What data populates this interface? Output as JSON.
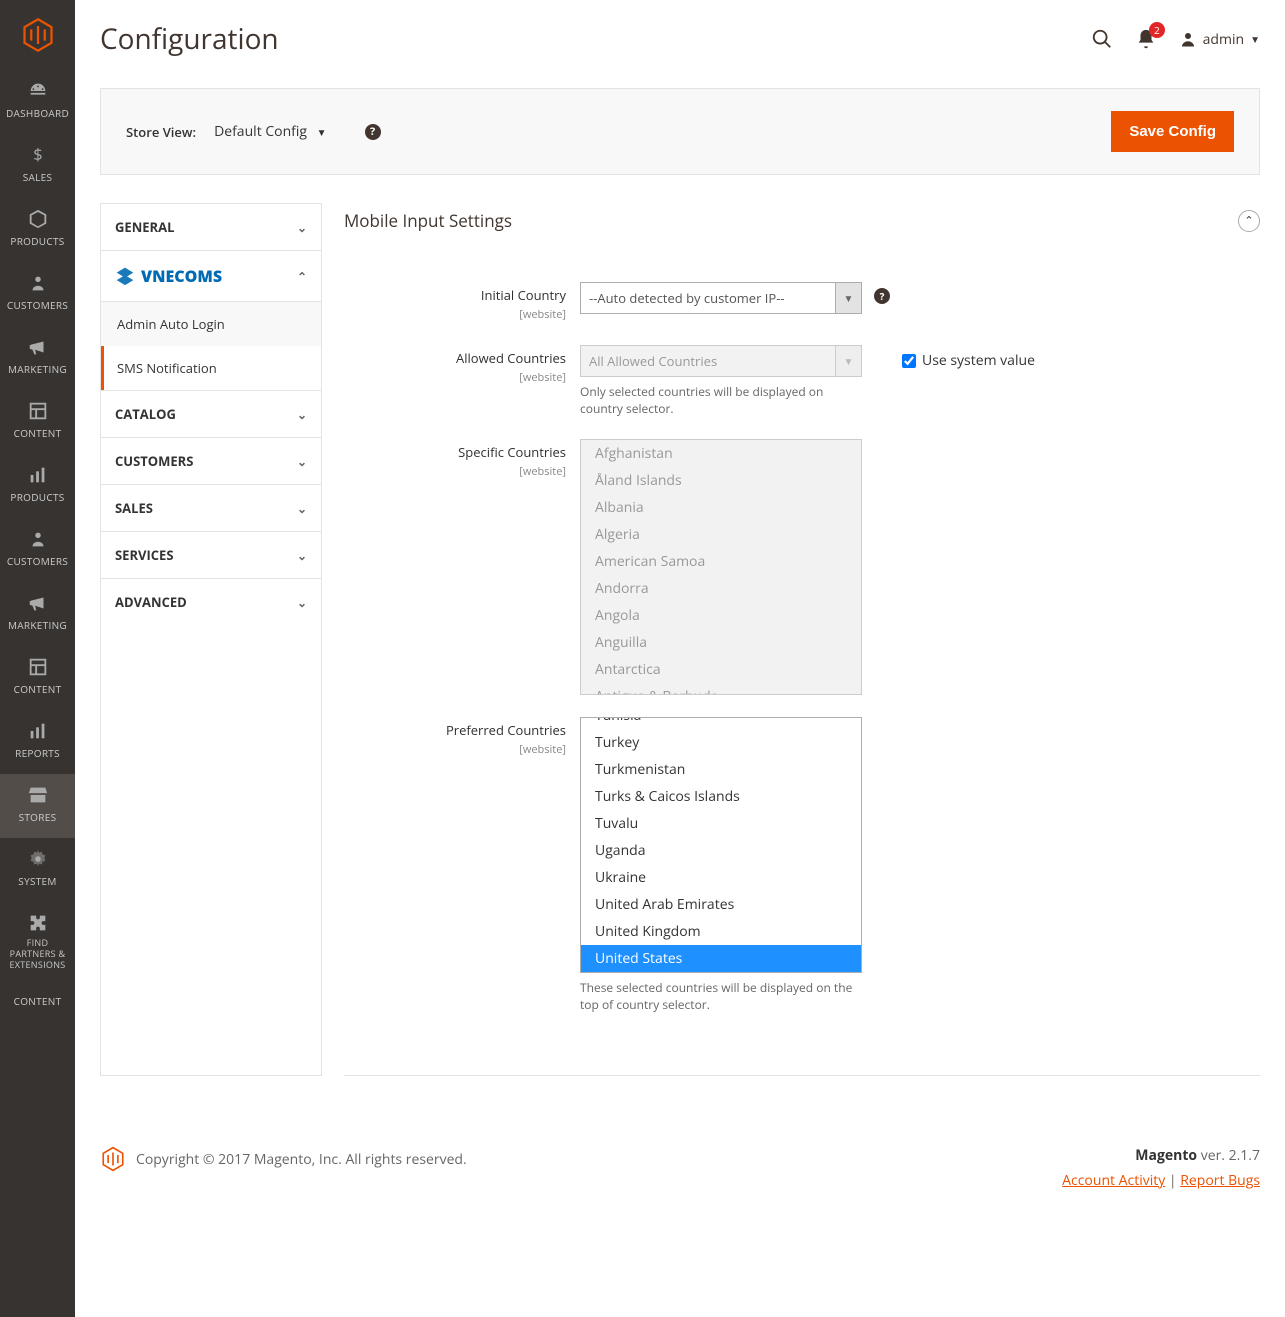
{
  "sidebar": {
    "items": [
      {
        "label": "DASHBOARD"
      },
      {
        "label": "SALES"
      },
      {
        "label": "PRODUCTS"
      },
      {
        "label": "CUSTOMERS"
      },
      {
        "label": "MARKETING"
      },
      {
        "label": "CONTENT"
      },
      {
        "label": "PRODUCTS"
      },
      {
        "label": "CUSTOMERS"
      },
      {
        "label": "MARKETING"
      },
      {
        "label": "CONTENT"
      },
      {
        "label": "REPORTS"
      },
      {
        "label": "STORES"
      },
      {
        "label": "SYSTEM"
      },
      {
        "label": "FIND PARTNERS & EXTENSIONS"
      },
      {
        "label": "CONTENT"
      }
    ]
  },
  "header": {
    "title": "Configuration",
    "notification_count": "2",
    "user": "admin"
  },
  "toolbar": {
    "store_view_label": "Store View:",
    "store_view_value": "Default Config",
    "save_label": "Save Config"
  },
  "config_nav": {
    "general": "GENERAL",
    "vnecoms": "VNECOMS",
    "vnecoms_sub": {
      "admin_auto_login": "Admin Auto Login",
      "sms_notification": "SMS Notification"
    },
    "catalog": "CATALOG",
    "customers": "CUSTOMERS",
    "sales": "SALES",
    "services": "SERVICES",
    "advanced": "ADVANCED"
  },
  "section": {
    "title": "Mobile Input Settings",
    "fields": {
      "initial_country": {
        "label": "Initial Country",
        "scope": "[website]",
        "value": "--Auto detected by customer IP--"
      },
      "allowed_countries": {
        "label": "Allowed Countries",
        "scope": "[website]",
        "value": "All Allowed Countries",
        "hint": "Only selected countries will be displayed on country selector.",
        "use_system_label": "Use system value"
      },
      "specific_countries": {
        "label": "Specific Countries",
        "scope": "[website]",
        "options": [
          "Afghanistan",
          "Åland Islands",
          "Albania",
          "Algeria",
          "American Samoa",
          "Andorra",
          "Angola",
          "Anguilla",
          "Antarctica",
          "Antigua & Barbuda"
        ]
      },
      "preferred_countries": {
        "label": "Preferred Countries",
        "scope": "[website]",
        "options": [
          "Tunisia",
          "Turkey",
          "Turkmenistan",
          "Turks & Caicos Islands",
          "Tuvalu",
          "Uganda",
          "Ukraine",
          "United Arab Emirates",
          "United Kingdom",
          "United States"
        ],
        "selected": "United States",
        "hint": "These selected countries will be displayed on the top of country selector."
      }
    }
  },
  "footer": {
    "copyright": "Copyright © 2017 Magento, Inc. All rights reserved.",
    "brand": "Magento",
    "version": " ver. 2.1.7",
    "account_activity": "Account Activity",
    "report_bugs": "Report Bugs"
  }
}
